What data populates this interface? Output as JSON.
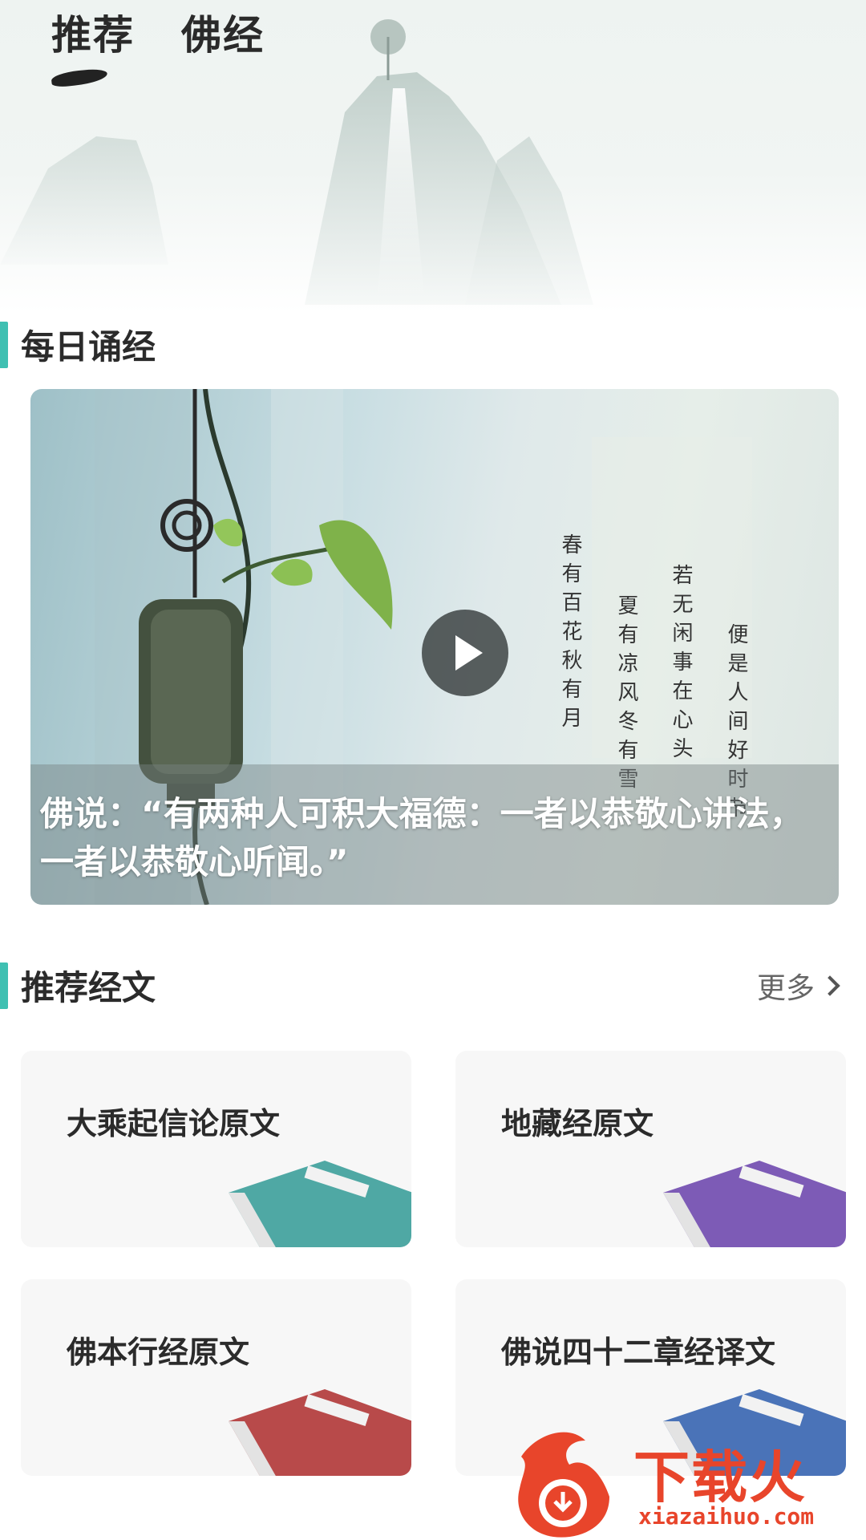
{
  "header": {
    "tabs": [
      {
        "label": "推荐",
        "active": true
      },
      {
        "label": "佛经",
        "active": false
      }
    ]
  },
  "daily": {
    "section_title": "每日诵经",
    "video": {
      "caption": "佛说：“有两种人可积大福德：一者以恭敬心讲法，一者以恭敬心听闻。”",
      "poem_lines": [
        "便是人间好时节",
        "若无闲事在心头",
        "夏有凉风冬有雪",
        "春有百花秋有月"
      ]
    }
  },
  "recommended": {
    "section_title": "推荐经文",
    "more_label": "更多",
    "cards": [
      {
        "title": "大乘起信论原文",
        "book_color": "#4fa8a4"
      },
      {
        "title": "地藏经原文",
        "book_color": "#7d5bb6"
      },
      {
        "title": "佛本行经原文",
        "book_color": "#b84a4a"
      },
      {
        "title": "佛说四十二章经译文",
        "book_color": "#4a73b8"
      }
    ]
  },
  "watermark": {
    "text": "下载火",
    "url": "xiazaihuo.com"
  },
  "colors": {
    "accent": "#3fc0b2",
    "brand_watermark": "#e8452b"
  }
}
